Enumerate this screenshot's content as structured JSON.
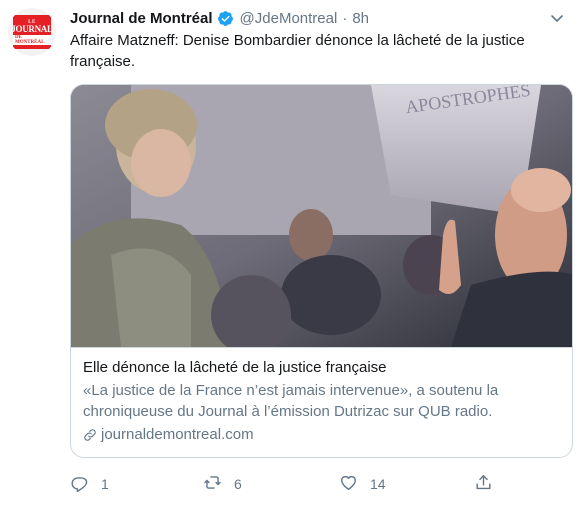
{
  "tweet": {
    "author_name": "Journal de Montréal",
    "handle": "@JdeMontreal",
    "separator": "·",
    "time": "8h",
    "text": "Affaire Matzneff: Denise Bombardier dénonce la lâcheté de la justice française.",
    "avatar": {
      "line1": "LE",
      "line2": "JOURNAL",
      "line3": "DE MONTRÉAL"
    },
    "icons": {
      "verified": "verified-badge-icon",
      "more": "chevron-down-icon"
    }
  },
  "card": {
    "image_sign_text": "APOSTROPHES",
    "title": "Elle dénonce la lâcheté de la justice française",
    "description": "«La justice de la France n’est jamais intervenue», a soutenu la chroniqueuse du Journal à l’émission Dutrizac sur QUB radio.",
    "domain": "journaldemontreal.com"
  },
  "actions": {
    "reply_count": "1",
    "retweet_count": "6",
    "like_count": "14"
  },
  "colors": {
    "text": "#14171a",
    "secondary": "#657786",
    "border": "#ccd6dd",
    "verified": "#1da1f2",
    "brand_red": "#e41f26"
  }
}
